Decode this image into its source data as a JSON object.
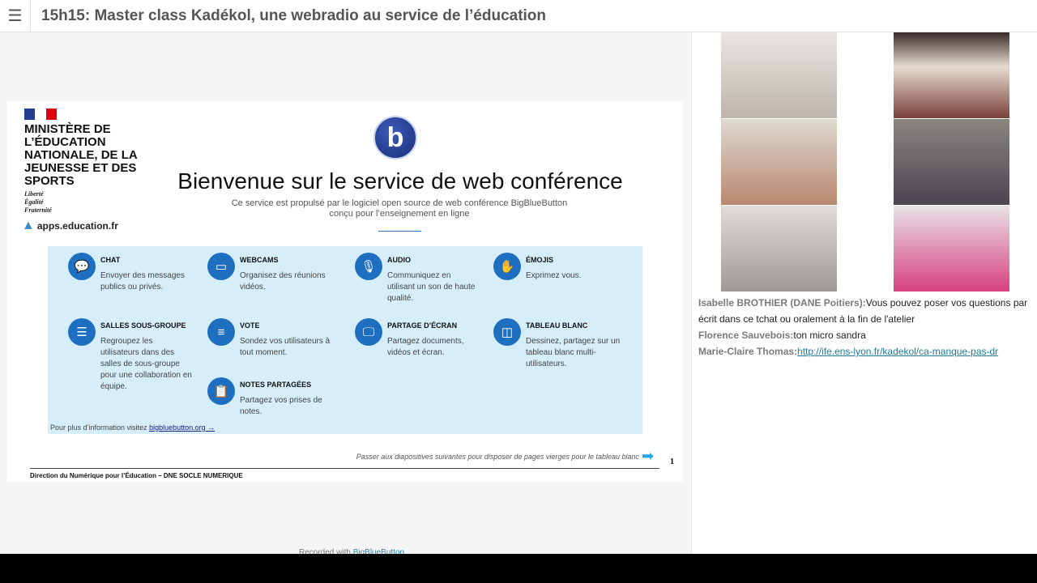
{
  "header": {
    "title": "15h15: Master class Kadékol, une webradio au service de l’éducation",
    "menu_icon": "hamburger-icon"
  },
  "slide": {
    "ministry": "MINISTÈRE DE L’ÉDUCATION NATIONALE, DE LA JEUNESSE ET DES SPORTS",
    "motto": [
      "Liberté",
      "Égalité",
      "Fraternité"
    ],
    "apps_logo": "apps.education.fr",
    "bbb_logo": "b",
    "title": "Bienvenue sur le service de web conférence",
    "subtitle1": "Ce service est propulsé par le logiciel open source de web conférence BigBlueButton",
    "subtitle2": "conçu pour l’enseignement en ligne",
    "features": [
      {
        "title": "CHAT",
        "desc": "Envoyer des messages publics ou privés.",
        "icon": "chat-icon"
      },
      {
        "title": "WEBCAMS",
        "desc": "Organisez des réunions vidéos.",
        "icon": "webcam-icon"
      },
      {
        "title": "AUDIO",
        "desc": "Communiquez en utilisant un son de haute qualité.",
        "icon": "microphone-icon"
      },
      {
        "title": "ÉMOJIS",
        "desc": "Exprimez vous.",
        "icon": "hand-icon"
      },
      {
        "title": "SALLES SOUS-GROUPE",
        "desc": "Regroupez les utilisateurs dans des salles de sous-groupe pour une collaboration en équipe.",
        "icon": "breakout-icon"
      },
      {
        "title": "VOTE",
        "desc": "Sondez vos utilisateurs à tout moment.",
        "icon": "poll-icon"
      },
      {
        "title": "PARTAGE D’ÉCRAN",
        "desc": "Partagez documents, vidéos et écran.",
        "icon": "screen-icon"
      },
      {
        "title": "TABLEAU BLANC",
        "desc": "Dessinez, partagez sur un tableau blanc multi-utilisateurs.",
        "icon": "whiteboard-icon"
      },
      {
        "title": "NOTES PARTAGÉES",
        "desc": "Partagez vos prises de notes.",
        "icon": "notes-icon"
      }
    ],
    "more_text": "Pour plus d’information visitez ",
    "more_link": "bigbluebutton.org →",
    "next_text": "Passer aux diapositives suivantes pour disposer de pages vierges pour le tableau blanc",
    "page_number": "1",
    "footer": "Direction du Numérique pour l’Éducation – DNE SOCLE NUMERIQUE"
  },
  "recorded": {
    "text": "Recorded with ",
    "link": "BigBlueButton"
  },
  "chat": [
    {
      "name": "Isabelle BROTHIER (DANE Poitiers):",
      "message": "Vous pouvez poser vos questions par écrit dans ce tchat ou oralement à la fin de l'atelier"
    },
    {
      "name": "Florence Sauvebois:",
      "message": "ton micro sandra"
    },
    {
      "name": "Marie-Claire Thomas:",
      "link": "http://ife.ens-lyon.fr/kadekol/ca-manque-pas-dr"
    }
  ]
}
